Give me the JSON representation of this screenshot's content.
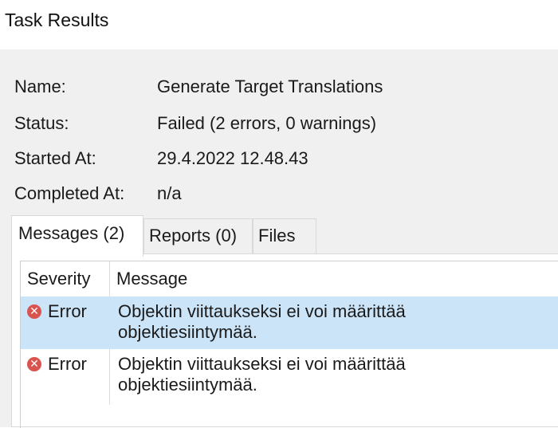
{
  "window": {
    "title": "Task Results"
  },
  "details": [
    {
      "label": "Name:",
      "value": "Generate Target Translations"
    },
    {
      "label": "Status:",
      "value": "Failed (2 errors, 0 warnings)"
    },
    {
      "label": "Started At:",
      "value": "29.4.2022 12.48.43"
    },
    {
      "label": "Completed At:",
      "value": "n/a"
    }
  ],
  "tabs": [
    {
      "label": "Messages (2)",
      "active": true
    },
    {
      "label": "Reports (0)",
      "active": false
    },
    {
      "label": "Files",
      "active": false
    }
  ],
  "messages": {
    "columns": [
      "Severity",
      "Message"
    ],
    "rows": [
      {
        "icon": "error-icon",
        "severity": "Error",
        "message_line1": "Objektin viittaukseksi ei voi määrittää",
        "message_line2": "objektiesiintymää.",
        "selected": true
      },
      {
        "icon": "error-icon",
        "severity": "Error",
        "message_line1": "Objektin viittaukseksi ei voi määrittää",
        "message_line2": "objektiesiintymää.",
        "selected": false
      }
    ]
  },
  "colors": {
    "selected_row": "#cce4f7",
    "error_icon": "#d9534f",
    "panel_bg": "#f0f0f0"
  }
}
